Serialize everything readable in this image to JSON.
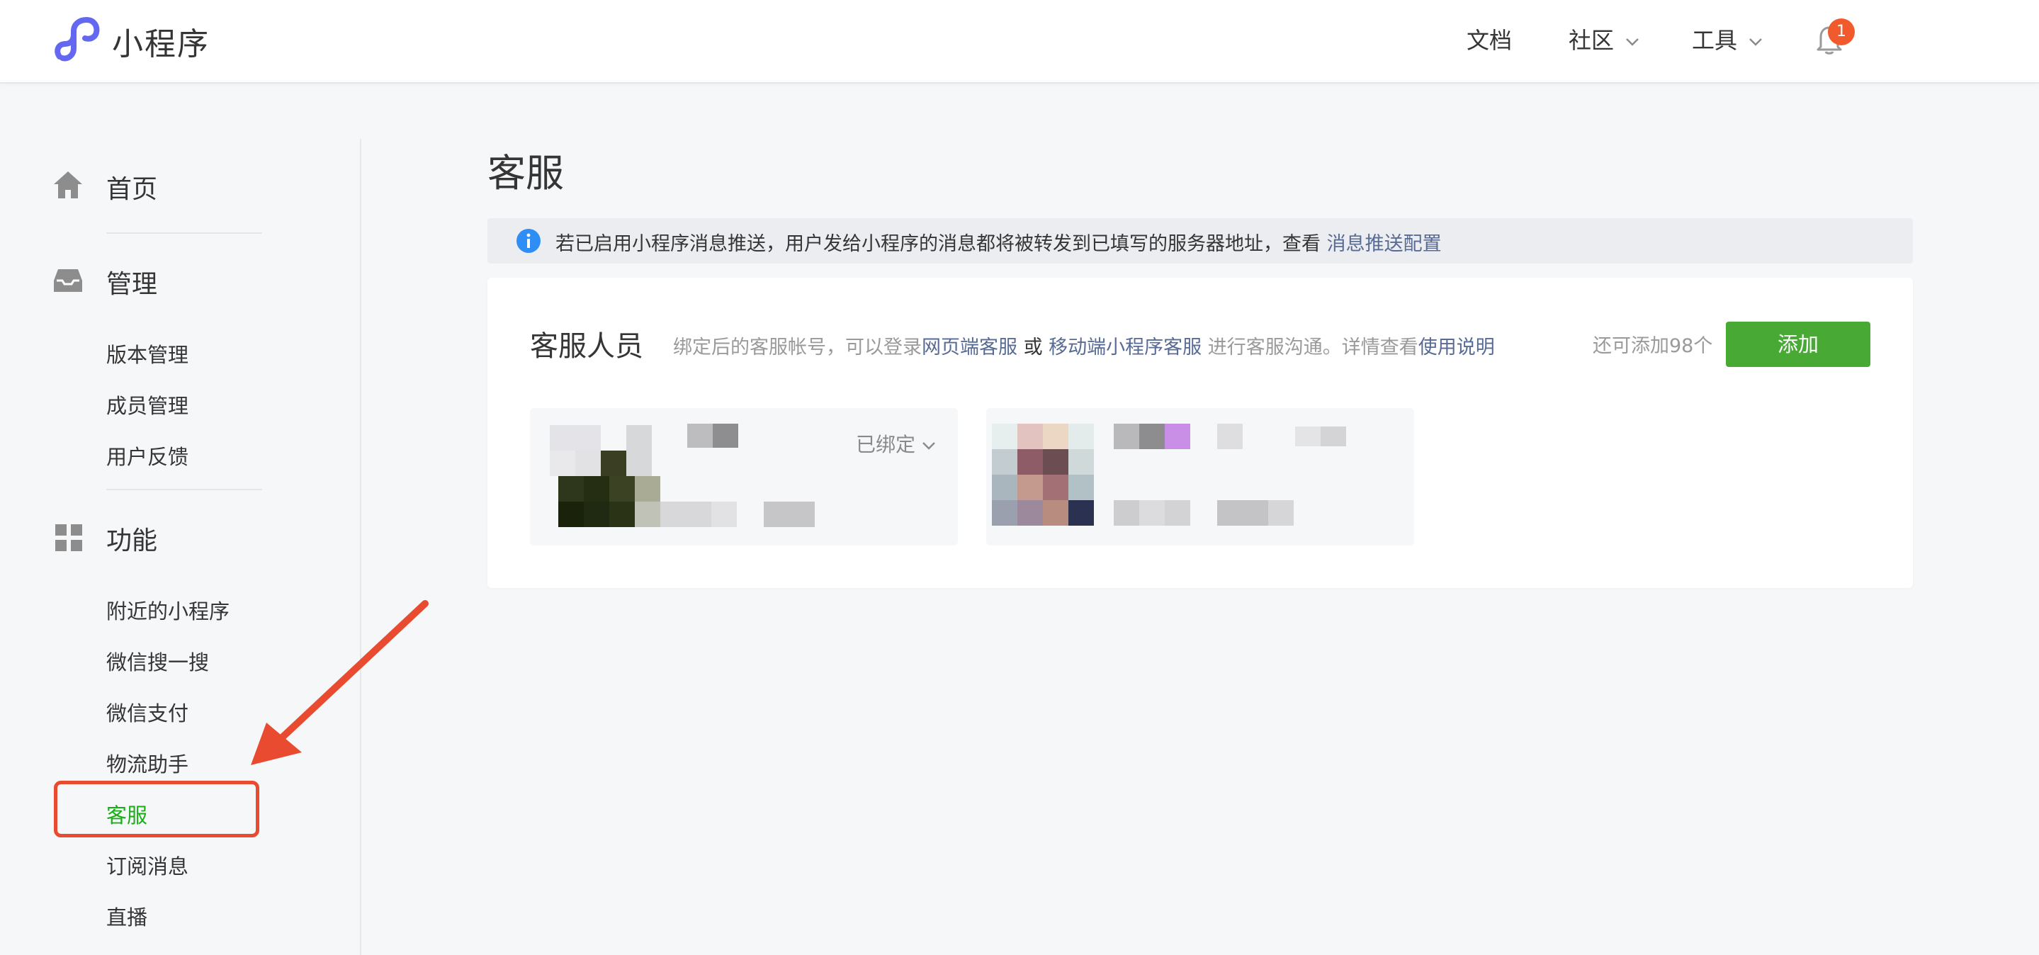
{
  "header": {
    "app_title": "小程序",
    "nav": [
      {
        "label": "文档",
        "has_dropdown": false
      },
      {
        "label": "社区",
        "has_dropdown": true
      },
      {
        "label": "工具",
        "has_dropdown": true
      }
    ],
    "notification_count": "1"
  },
  "sidebar": {
    "home": "首页",
    "manage": {
      "title": "管理",
      "items": [
        "版本管理",
        "成员管理",
        "用户反馈"
      ]
    },
    "features": {
      "title": "功能",
      "items": [
        "附近的小程序",
        "微信搜一搜",
        "微信支付",
        "物流助手",
        "客服",
        "订阅消息",
        "直播"
      ],
      "active": "客服"
    }
  },
  "main": {
    "title": "客服",
    "notice": {
      "text": "若已启用小程序消息推送，用户发给小程序的消息都将被转发到已填写的服务器地址，查看",
      "link": "消息推送配置"
    },
    "card": {
      "title": "客服人员",
      "desc_prefix": "绑定后的客服帐号，可以登录",
      "desc_link1": "网页端客服",
      "desc_or": " 或 ",
      "desc_link2": "移动端小程序客服",
      "desc_mid": " 进行客服沟通。详情查看",
      "desc_link3": "使用说明",
      "remaining": "还可添加98个",
      "add_label": "添加",
      "member_status": "已绑定"
    }
  },
  "colors": {
    "accent_green": "#48a935",
    "link_blue": "#576b95",
    "annotation_red": "#e84b30",
    "badge_red": "#f05a2c"
  }
}
